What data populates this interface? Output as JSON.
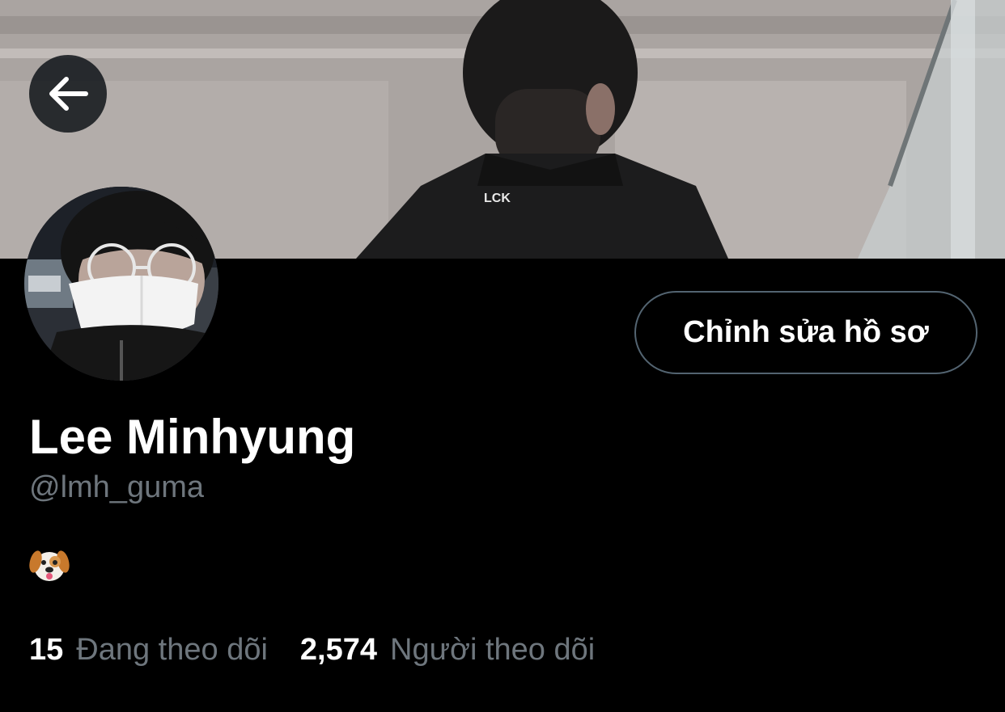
{
  "profile": {
    "name": "Lee Minhyung",
    "handle": "@lmh_guma",
    "bio_icon": "dog-face-icon",
    "edit_label": "Chỉnh sửa hồ sơ",
    "back_icon": "arrow-left-icon"
  },
  "stats": {
    "following_count": "15",
    "following_label": "Đang theo dõi",
    "followers_count": "2,574",
    "followers_label": "Người theo dõi"
  },
  "banner": {
    "jacket_text": "LCK"
  },
  "colors": {
    "background": "#000000",
    "secondary_text": "#6e767d",
    "button_border": "#536471",
    "primary_text": "#ffffff"
  }
}
